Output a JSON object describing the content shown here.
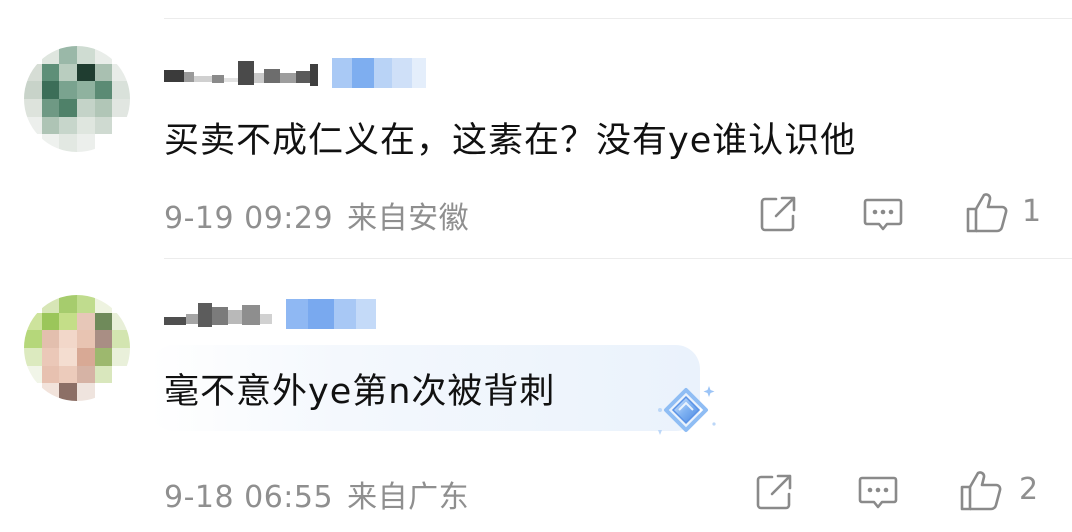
{
  "comments": [
    {
      "text": "买卖不成仁义在，这素在？没有ye谁认识他",
      "date": "9-19 09:29",
      "location": "来自安徽",
      "like_count": "1"
    },
    {
      "text": "毫不意外ye第n次被背刺",
      "date": "9-18 06:55",
      "location": "来自广东",
      "like_count": "2"
    }
  ],
  "icons": {
    "share": "share-icon",
    "comment": "comment-icon",
    "like": "thumbs-up-icon",
    "badge": "diamond-badge-icon"
  },
  "colors": {
    "text": "#111111",
    "meta": "#8f8f8f",
    "divider": "#ececec",
    "badge_blue": "#6aa6f0"
  }
}
